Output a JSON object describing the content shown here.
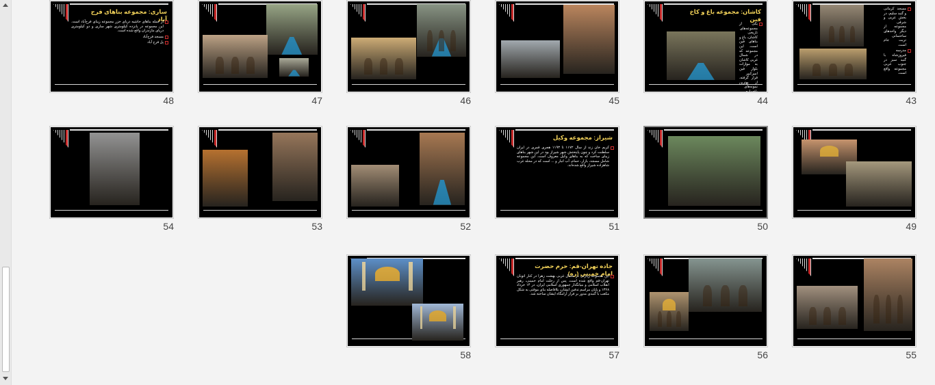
{
  "window": {
    "view": "slide-sorter"
  },
  "colors": {
    "sorter_background": "#f3f3f3",
    "slide_background": "#000000",
    "title_text": "#f5d45a",
    "bullet_marker": "#d32f2f",
    "slide_number": "#444444"
  },
  "slides": [
    {
      "number": "43",
      "title": "",
      "body": [
        "مسجد کرمانی و گنبد سلیم، در بخش غربی و شرقی مجموعه از دیگر واحدهای ساختمانی تربت جام است.",
        "مدرسه فیروزشاه با گنبد سبز در جنوب غربی مجموعه واقع است."
      ],
      "images": [
        "mausoleum-exterior",
        "mosque-facade"
      ]
    },
    {
      "number": "44",
      "title": "کاشان: مجموعه باغ و کاخ فین",
      "body": [
        "یکی از مجموعه‌های تاریخی کاشان، باغ و بناهای فین است. این مجموعه که در شمال غربی کاشان به موازات بلوار فین امیرکبیر قرار گرفته، از بهترین نمونه‌های باغ‌سازی ایرانی است و در مجاورت چشمه سلیمانیه به‌وجود آمده است."
      ],
      "images": [
        "fin-garden-pool"
      ]
    },
    {
      "number": "45",
      "title": "",
      "body": [],
      "images": [
        "fort-tower",
        "bazaar-corridor"
      ]
    },
    {
      "number": "46",
      "title": "",
      "body": [],
      "images": [
        "madrasa-courtyard",
        "garden-pool-facade"
      ]
    },
    {
      "number": "47",
      "title": "",
      "body": [],
      "images": [
        "fin-garden-canal",
        "traditional-house",
        "pavilion-pool"
      ]
    },
    {
      "number": "48",
      "title": "ساری: مجموعه بناهای فرح آباد",
      "body": [
        "از جمله بناهای حاشیه دریای خزر مجموعه زیبای فرح‌آباد است. این مجموعه در پانزده کیلومتری شهر ساری و دو کیلومتری دریای مازندران واقع شده است.",
        "مسجد فرح‌آباد",
        "پل فرح آباد"
      ],
      "images": []
    },
    {
      "number": "49",
      "title": "",
      "body": [],
      "images": [
        "brick-dome",
        "ruined-walls"
      ]
    },
    {
      "number": "50",
      "title": "",
      "body": [],
      "images": [
        "dam-waterfall"
      ]
    },
    {
      "number": "51",
      "title": "شیراز: مجموعه وکیل",
      "body": [
        "کریم خان زند از سال ۱۱۷۲ تا ۱۱۹۳ هجری قمری در ایران سلطنت کرد و چون پایتختش شهر شیراز بود در این شهر بناهای زیبای ساخت که به بناهای وکیل معروف است. این مجموعه شامل مسجد، بازار، حمام، آب انبار و ... است که در محله غرب شاهزاده شیراز واقع شده‌اند."
      ],
      "images": []
    },
    {
      "number": "52",
      "title": "",
      "body": [],
      "images": [
        "mosque-reflection",
        "city-aerial"
      ]
    },
    {
      "number": "53",
      "title": "",
      "body": [],
      "images": [
        "bazaar-night",
        "bazaar-vault"
      ]
    },
    {
      "number": "54",
      "title": "",
      "body": [],
      "images": [
        "bazaar-archive-photo"
      ]
    },
    {
      "number": "55",
      "title": "",
      "body": [],
      "images": [
        "tiled-portal",
        "brick-arcade"
      ]
    },
    {
      "number": "56",
      "title": "",
      "body": [],
      "images": [
        "bathhouse-interior",
        "bathhouse-dome"
      ]
    },
    {
      "number": "57",
      "title": "جاده تهران-قم: حرم حضرت امام خمینی (ره)",
      "body": [
        "این مجموعه زیارتی در شمال غربی بهشت زهرا در کنار اتوبان تهران-قم واقع شده است. پس از رحلت امام خمینی، رهبر انقلاب اسلامی و بنیانگذار جمهوری اسلامی ایران، در ۱۴ خرداد ۱۳۶۸ و پایان مراسم تدفین ایشان، بلافاصله بنای موقتی به شکل مکعب با گنبدی مدور بر فراز آرامگاه ایشان ساخته شد."
      ],
      "images": []
    },
    {
      "number": "58",
      "title": "",
      "body": [],
      "images": [
        "golden-dome-shrine",
        "shrine-minarets"
      ]
    }
  ]
}
